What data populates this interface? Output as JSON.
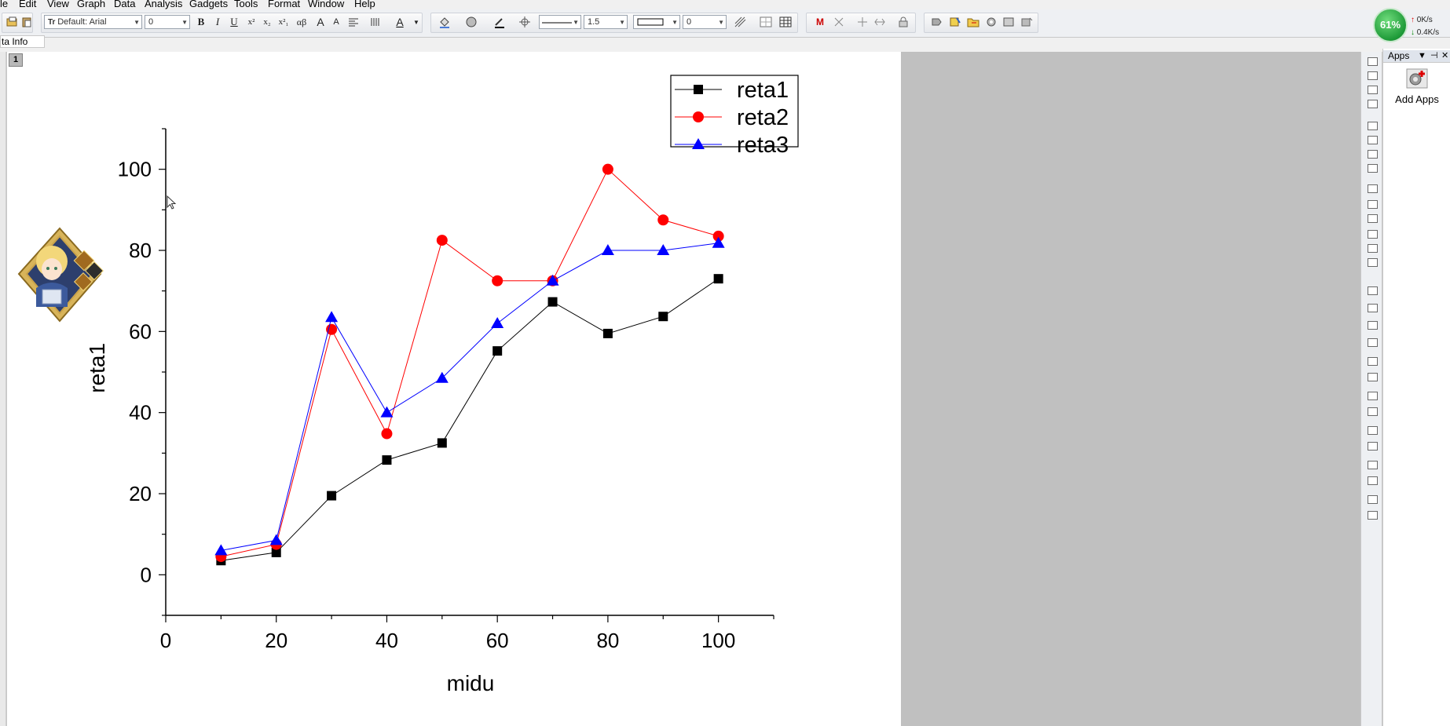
{
  "menubar": {
    "items": [
      "le",
      "Edit",
      "View",
      "Graph",
      "Data",
      "Analysis",
      "Gadgets",
      "Tools",
      "Format",
      "Window",
      "Help"
    ]
  },
  "toolbar": {
    "font_name": "Default: Arial",
    "font_size": "0",
    "line_width": "1.5",
    "pattern_value": "0"
  },
  "info_tab": {
    "label": "ta Info"
  },
  "layer_badge": {
    "label": "1"
  },
  "cpu_widget": {
    "percent": "61%",
    "upload": "0K/s",
    "download": "0.4K/s"
  },
  "apps_panel": {
    "title": "Apps",
    "add_apps_label": "Add Apps"
  },
  "chart_data": {
    "type": "line",
    "xlabel": "midu",
    "ylabel": "reta1",
    "xlim": [
      0,
      110
    ],
    "ylim": [
      -10,
      110
    ],
    "xticks": [
      "0",
      "20",
      "40",
      "60",
      "80",
      "100"
    ],
    "yticks": [
      "0",
      "20",
      "40",
      "60",
      "80",
      "100"
    ],
    "legend_position": "top-right",
    "x": [
      10,
      20,
      30,
      40,
      50,
      60,
      70,
      80,
      90,
      100
    ],
    "series": [
      {
        "name": "reta1",
        "color": "#000000",
        "marker": "square",
        "values": [
          3.5,
          5.5,
          19.5,
          28.3,
          32.5,
          55.2,
          67.3,
          59.5,
          63.7,
          73
        ]
      },
      {
        "name": "reta2",
        "color": "#ff0000",
        "marker": "circle",
        "values": [
          4.5,
          7.5,
          60.5,
          34.8,
          82.5,
          72.5,
          72.5,
          100,
          87.5,
          83.5
        ]
      },
      {
        "name": "reta3",
        "color": "#0000ff",
        "marker": "triangle",
        "values": [
          6,
          8.5,
          63.5,
          40,
          48.5,
          62,
          72.5,
          80,
          80,
          81.8
        ]
      }
    ]
  }
}
